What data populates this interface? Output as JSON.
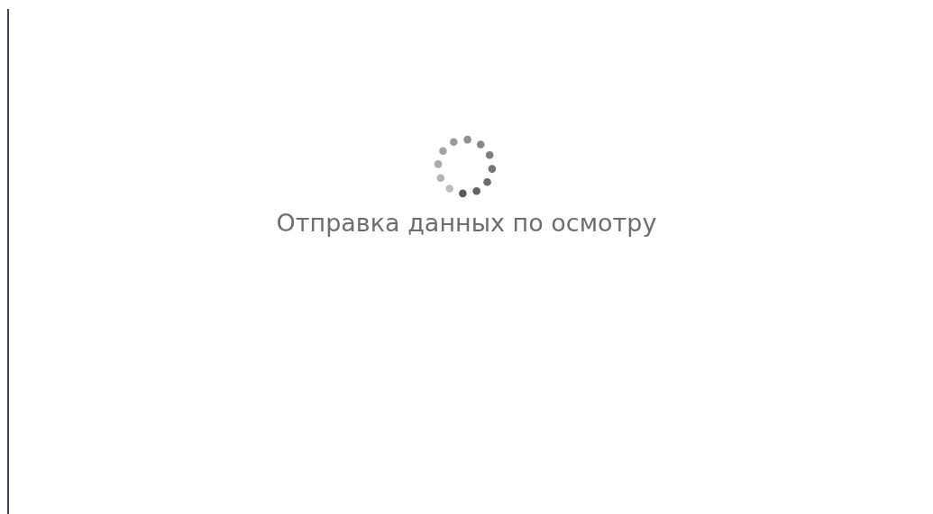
{
  "loading": {
    "message": "Отправка данных по осмотру"
  }
}
